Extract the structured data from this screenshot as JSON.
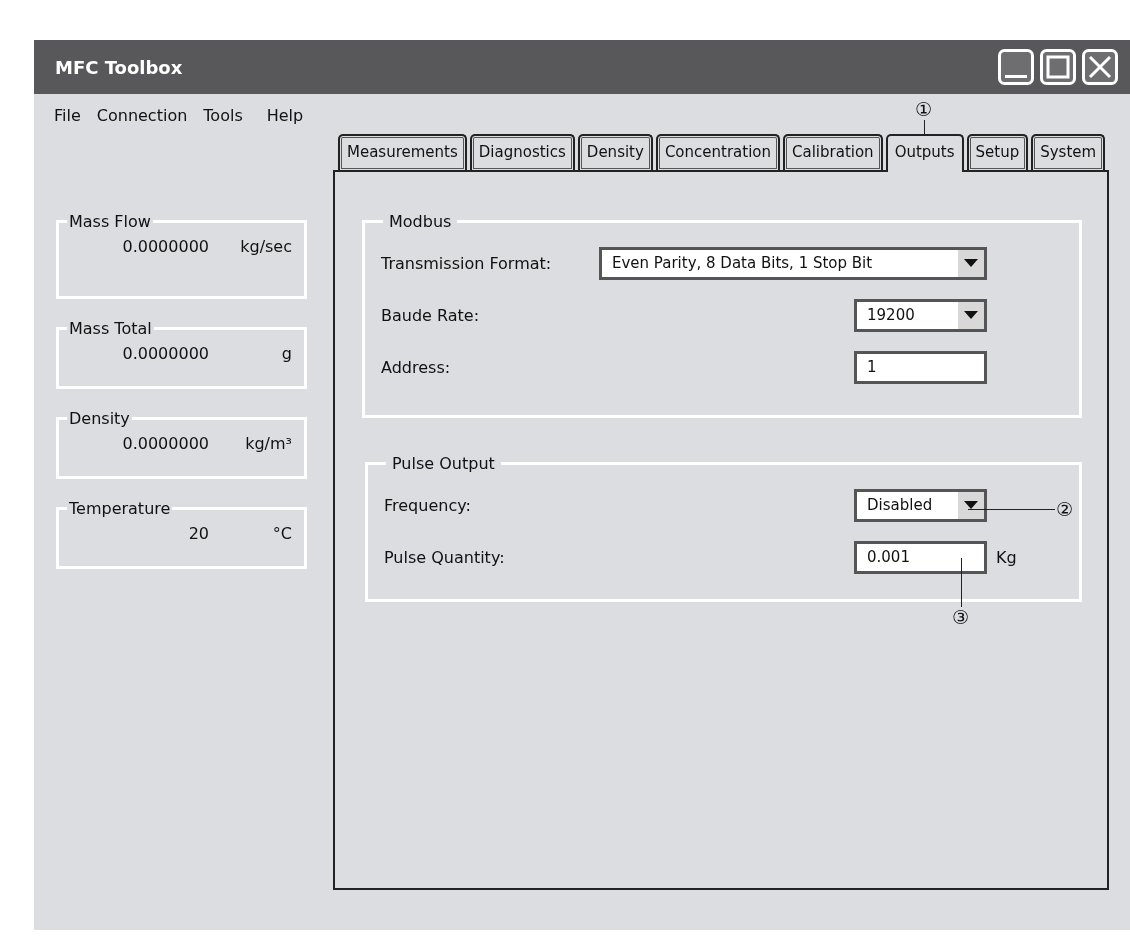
{
  "window": {
    "title": "MFC Toolbox"
  },
  "menu": [
    "File",
    "Connection",
    "Tools",
    "Help"
  ],
  "readouts": [
    {
      "label": "Mass Flow",
      "value": "0.0000000",
      "unit": "kg/sec"
    },
    {
      "label": "Mass Total",
      "value": "0.0000000",
      "unit": "g"
    },
    {
      "label": "Density",
      "value": "0.0000000",
      "unit": "kg/m³"
    },
    {
      "label": "Temperature",
      "value": "20",
      "unit": "°C"
    }
  ],
  "tabs": [
    {
      "label": "Measurements",
      "selected": false
    },
    {
      "label": "Diagnostics",
      "selected": false
    },
    {
      "label": "Density",
      "selected": false
    },
    {
      "label": "Concentration",
      "selected": false
    },
    {
      "label": "Calibration",
      "selected": false
    },
    {
      "label": "Outputs",
      "selected": true
    },
    {
      "label": "Setup",
      "selected": false
    },
    {
      "label": "System",
      "selected": false
    }
  ],
  "groups": [
    {
      "title": "Modbus",
      "fields": [
        {
          "kind": "dropdown",
          "label": "Transmission Format:",
          "value": "Even Parity, 8 Data Bits, 1 Stop Bit"
        },
        {
          "kind": "dropdown",
          "label": "Baude Rate:",
          "value": "19200"
        },
        {
          "kind": "input",
          "label": "Address:",
          "value": "1"
        }
      ]
    },
    {
      "title": "Pulse Output",
      "fields": [
        {
          "kind": "dropdown",
          "label": "Frequency:",
          "value": "Disabled"
        },
        {
          "kind": "input",
          "label": "Pulse Quantity:",
          "value": "0.001",
          "unit": "Kg"
        }
      ]
    }
  ],
  "callouts": [
    "①",
    "②",
    "③"
  ]
}
